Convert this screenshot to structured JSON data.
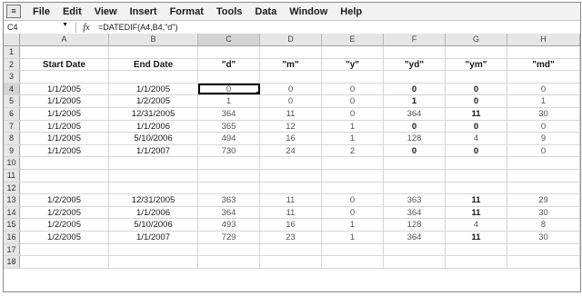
{
  "menu": {
    "app_icon": "≡",
    "items": [
      "File",
      "Edit",
      "View",
      "Insert",
      "Format",
      "Tools",
      "Data",
      "Window",
      "Help"
    ]
  },
  "formula_bar": {
    "name_box": "C4",
    "fx_label": "fx",
    "formula": "=DATEDIF(A4,B4,\"d\")"
  },
  "columns": [
    "A",
    "B",
    "C",
    "D",
    "E",
    "F",
    "G",
    "H"
  ],
  "rows": [
    {
      "n": "1",
      "cells": [
        "",
        "",
        "",
        "",
        "",
        "",
        "",
        ""
      ]
    },
    {
      "n": "2",
      "cells": [
        "Start Date",
        "End Date",
        "\"d\"",
        "\"m\"",
        "\"y\"",
        "\"yd\"",
        "\"ym\"",
        "\"md\""
      ]
    },
    {
      "n": "3",
      "cells": [
        "",
        "",
        "",
        "",
        "",
        "",
        "",
        ""
      ]
    },
    {
      "n": "4",
      "cells": [
        "1/1/2005",
        "1/1/2005",
        "0",
        "0",
        "0",
        "0",
        "0",
        "0"
      ]
    },
    {
      "n": "5",
      "cells": [
        "1/1/2005",
        "1/2/2005",
        "1",
        "0",
        "0",
        "1",
        "0",
        "1"
      ]
    },
    {
      "n": "6",
      "cells": [
        "1/1/2005",
        "12/31/2005",
        "364",
        "11",
        "0",
        "364",
        "11",
        "30"
      ]
    },
    {
      "n": "7",
      "cells": [
        "1/1/2005",
        "1/1/2006",
        "365",
        "12",
        "1",
        "0",
        "0",
        "0"
      ]
    },
    {
      "n": "8",
      "cells": [
        "1/1/2005",
        "5/10/2006",
        "494",
        "16",
        "1",
        "128",
        "4",
        "9"
      ]
    },
    {
      "n": "9",
      "cells": [
        "1/1/2005",
        "1/1/2007",
        "730",
        "24",
        "2",
        "0",
        "0",
        "0"
      ]
    },
    {
      "n": "10",
      "cells": [
        "",
        "",
        "",
        "",
        "",
        "",
        "",
        ""
      ]
    },
    {
      "n": "11",
      "cells": [
        "",
        "",
        "",
        "",
        "",
        "",
        "",
        ""
      ]
    },
    {
      "n": "12",
      "cells": [
        "",
        "",
        "",
        "",
        "",
        "",
        "",
        ""
      ]
    },
    {
      "n": "13",
      "cells": [
        "1/2/2005",
        "12/31/2005",
        "363",
        "11",
        "0",
        "363",
        "11",
        "29"
      ]
    },
    {
      "n": "14",
      "cells": [
        "1/2/2005",
        "1/1/2006",
        "364",
        "11",
        "0",
        "364",
        "11",
        "30"
      ]
    },
    {
      "n": "15",
      "cells": [
        "1/2/2005",
        "5/10/2006",
        "493",
        "16",
        "1",
        "128",
        "4",
        "8"
      ]
    },
    {
      "n": "16",
      "cells": [
        "1/2/2005",
        "1/1/2007",
        "729",
        "23",
        "1",
        "364",
        "11",
        "30"
      ]
    },
    {
      "n": "17",
      "cells": [
        "",
        "",
        "",
        "",
        "",
        "",
        "",
        ""
      ]
    },
    {
      "n": "18",
      "cells": [
        "",
        "",
        "",
        "",
        "",
        "",
        "",
        ""
      ]
    }
  ]
}
